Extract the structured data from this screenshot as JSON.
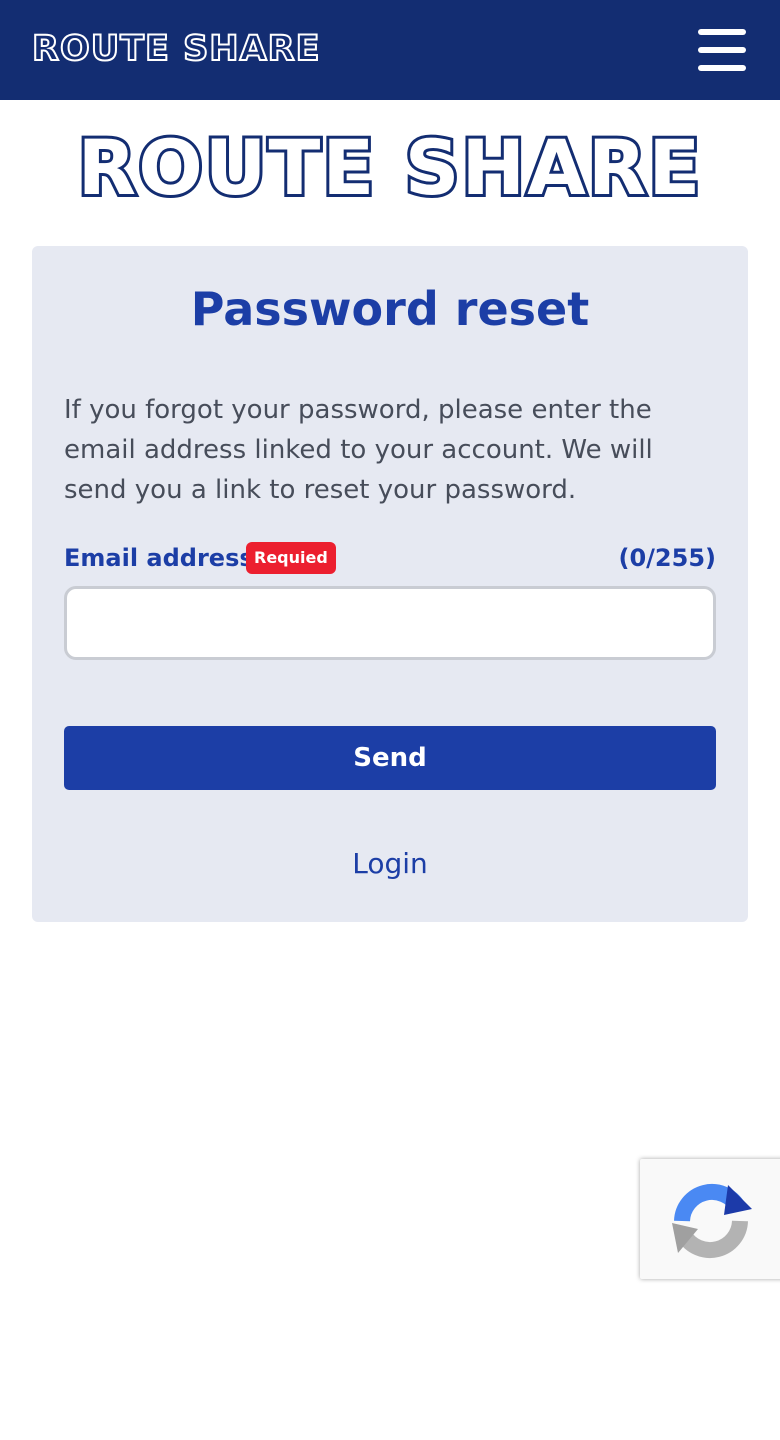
{
  "header": {
    "brand": "ROUTE SHARE",
    "menu_icon": "hamburger-menu-icon"
  },
  "logo": {
    "text": "ROUTE SHARE"
  },
  "form": {
    "title": "Password reset",
    "description": "If you forgot your password, please enter the email address linked to your account. We will send you a link to reset your password.",
    "email_label": "Email address",
    "required_badge": "Requied",
    "char_counter": "(0/255)",
    "email_value": "",
    "email_placeholder": "",
    "send_label": "Send",
    "login_label": "Login"
  },
  "recaptcha": {
    "icon": "recaptcha-icon"
  },
  "colors": {
    "header_bg": "#132d72",
    "accent": "#1c3ea6",
    "card_bg": "#e6e9f2",
    "required_red": "#ec1f2f",
    "body_text": "#474d5a"
  }
}
